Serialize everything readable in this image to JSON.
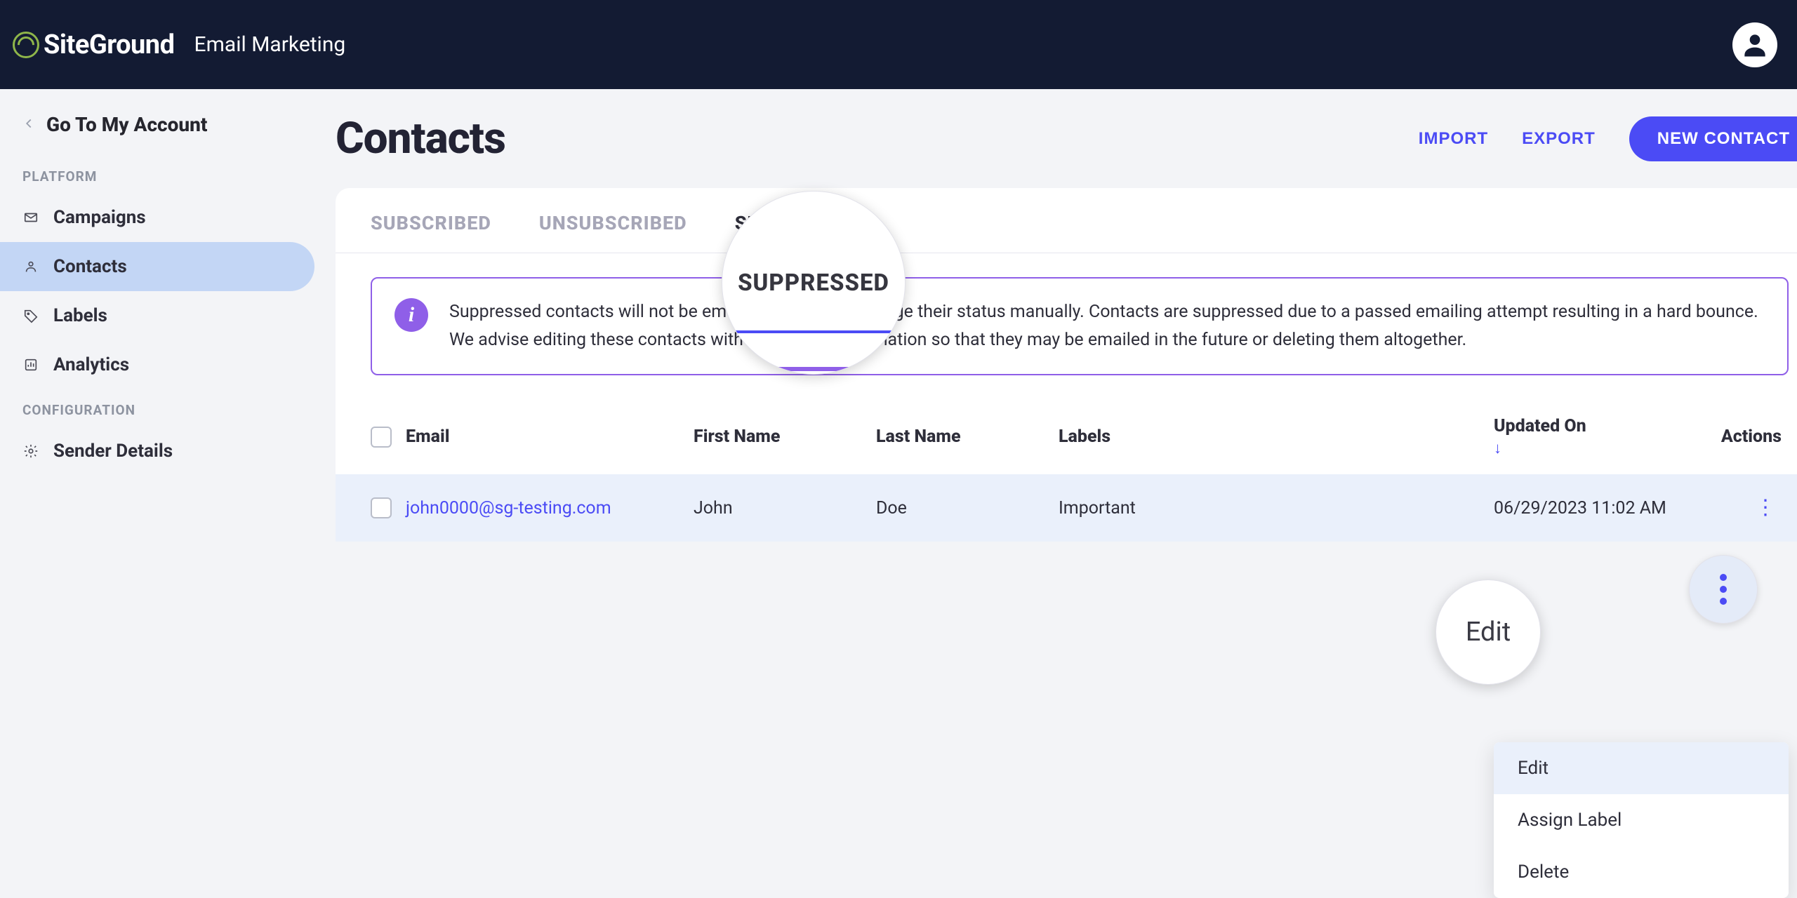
{
  "header": {
    "brand": "SiteGround",
    "product": "Email Marketing"
  },
  "sidebar": {
    "back_label": "Go To My Account",
    "sections": {
      "platform_title": "PLATFORM",
      "config_title": "CONFIGURATION"
    },
    "items": {
      "campaigns": "Campaigns",
      "contacts": "Contacts",
      "labels": "Labels",
      "analytics": "Analytics",
      "sender_details": "Sender Details"
    }
  },
  "page": {
    "title": "Contacts",
    "import": "IMPORT",
    "export": "EXPORT",
    "new_contact": "NEW CONTACT"
  },
  "tabs": {
    "subscribed": "SUBSCRIBED",
    "unsubscribed": "UNSUBSCRIBED",
    "suppressed": "SUPPRESSED"
  },
  "banner": {
    "text": "Suppressed contacts will not be emailed unless you change their status manually. Contacts are suppressed due to a passed emailing attempt resulting in a hard bounce. We advise editing these contacts with the correct information so that they may be emailed in the future or deleting them altogether."
  },
  "table": {
    "headers": {
      "email": "Email",
      "first_name": "First Name",
      "last_name": "Last Name",
      "labels": "Labels",
      "updated_on": "Updated On",
      "sort_arrow": "↓",
      "actions": "Actions"
    },
    "rows": [
      {
        "email": "john0000@sg-testing.com",
        "first_name": "John",
        "last_name": "Doe",
        "labels": "Important",
        "updated_on": "06/29/2023 11:02 AM"
      }
    ]
  },
  "dropdown": {
    "edit": "Edit",
    "assign_label": "Assign Label",
    "delete": "Delete"
  },
  "magnifiers": {
    "suppressed": "SUPPRESSED",
    "edit": "Edit"
  },
  "info_icon_char": "i"
}
